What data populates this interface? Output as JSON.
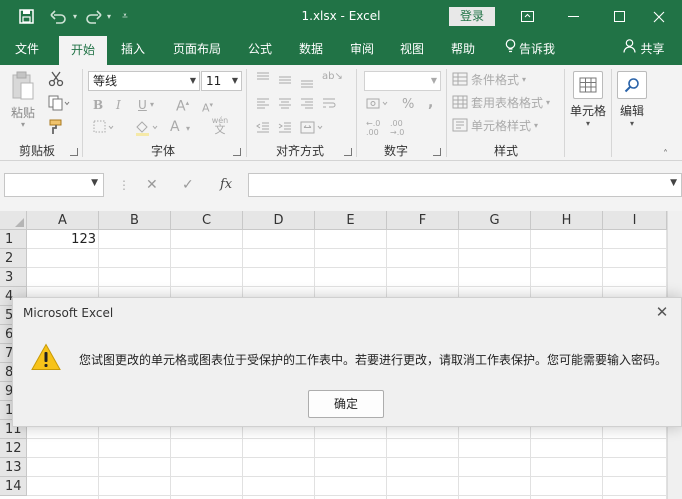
{
  "window": {
    "title": "1.xlsx  -  Excel",
    "login_label": "登录",
    "save_icon": "save-icon",
    "undo_icon": "undo-icon",
    "redo_icon": "redo-icon",
    "customize_icon": "customize-toolbar-icon"
  },
  "ribbon_tabs": [
    {
      "label": "文件"
    },
    {
      "label": "开始"
    },
    {
      "label": "插入"
    },
    {
      "label": "页面布局"
    },
    {
      "label": "公式"
    },
    {
      "label": "数据"
    },
    {
      "label": "审阅"
    },
    {
      "label": "视图"
    },
    {
      "label": "帮助"
    },
    {
      "label": "告诉我"
    },
    {
      "label": "共享"
    }
  ],
  "ribbon": {
    "clipboard": {
      "paste_label": "粘贴",
      "group_label": "剪贴板"
    },
    "font": {
      "font_name": "等线",
      "font_size": "11",
      "group_label": "字体",
      "bold": "B",
      "italic": "I",
      "underline": "U",
      "font_color": "A",
      "grow": "A",
      "shrink": "A",
      "phonetic": "wén"
    },
    "alignment": {
      "group_label": "对齐方式"
    },
    "number": {
      "format": "",
      "group_label": "数字",
      "percent": "%",
      "comma": ","
    },
    "styles": {
      "conditional_label": "条件格式",
      "table_label": "套用表格格式",
      "cell_styles_label": "单元格样式",
      "group_label": "样式"
    },
    "cells": {
      "label": "单元格"
    },
    "editing": {
      "label": "编辑"
    }
  },
  "formula_bar": {
    "name_box": "",
    "fx_label": "fx",
    "formula": ""
  },
  "grid": {
    "columns": [
      "A",
      "B",
      "C",
      "D",
      "E",
      "F",
      "G",
      "H",
      "I"
    ],
    "rows": [
      "1",
      "2",
      "3",
      "4",
      "5",
      "6",
      "7",
      "8",
      "9",
      "10",
      "11",
      "12",
      "13",
      "14"
    ],
    "cells": {
      "A1": "123"
    }
  },
  "dialog": {
    "title": "Microsoft Excel",
    "message": "您试图更改的单元格或图表位于受保护的工作表中。若要进行更改，请取消工作表保护。您可能需要输入密码。",
    "ok_label": "确定",
    "warning_icon": "warning-icon",
    "close_icon": "close-icon"
  },
  "colors": {
    "brand": "#217346",
    "ribbon_bg": "#f3f3f3",
    "warning": "#f7c31a"
  }
}
